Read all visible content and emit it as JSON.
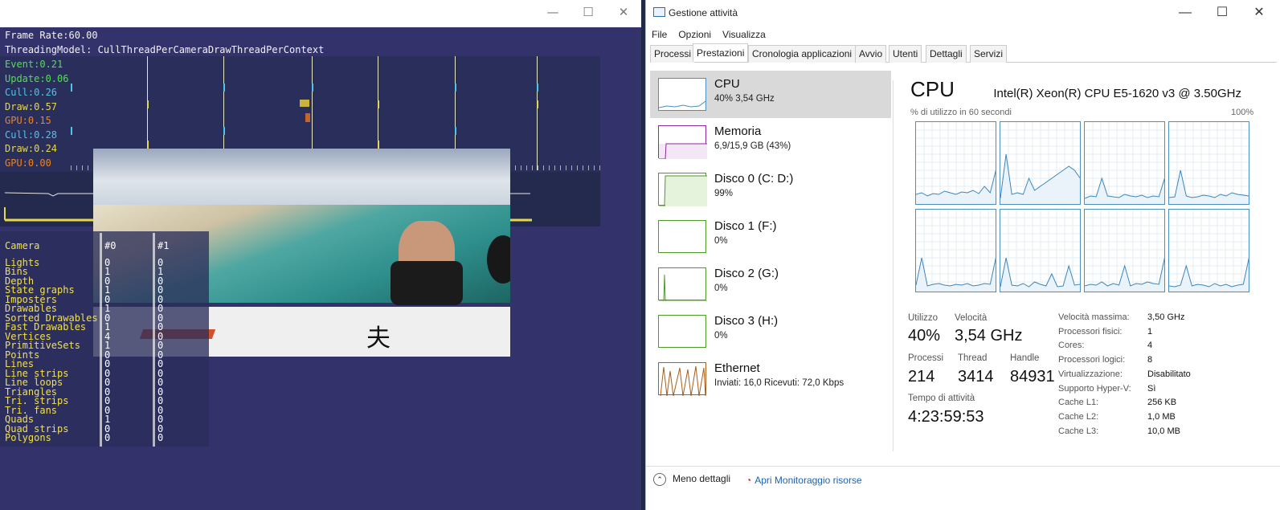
{
  "osg": {
    "frame_rate": "Frame Rate:60.00",
    "threading": "ThreadingModel: CullThreadPerCameraDrawThreadPerContext",
    "stats": [
      {
        "label": "Event:0.21",
        "color": "#4ee34e"
      },
      {
        "label": "Update:0.06",
        "color": "#4ee34e"
      },
      {
        "label": "Cull:0.26",
        "color": "#4cc7e6"
      },
      {
        "label": "Draw:0.57",
        "color": "#e6d84c"
      },
      {
        "label": "GPU:0.15",
        "color": "#e8842a"
      },
      {
        "label": "Cull:0.28",
        "color": "#4cc7e6"
      },
      {
        "label": "Draw:0.24",
        "color": "#e6d84c"
      },
      {
        "label": "GPU:0.00",
        "color": "#e8842a"
      }
    ],
    "camera": {
      "header": "Camera",
      "col0": "#0",
      "col1": "#1",
      "rows": [
        {
          "name": "Lights",
          "c0": "0",
          "c1": "0"
        },
        {
          "name": "Bins",
          "c0": "1",
          "c1": "1"
        },
        {
          "name": "Depth",
          "c0": "0",
          "c1": "0"
        },
        {
          "name": "State graphs",
          "c0": "1",
          "c1": "0"
        },
        {
          "name": "Imposters",
          "c0": "0",
          "c1": "0"
        },
        {
          "name": "Drawables",
          "c0": "1",
          "c1": "0"
        },
        {
          "name": "Sorted Drawables",
          "c0": "0",
          "c1": "0"
        },
        {
          "name": "Fast Drawables",
          "c0": "1",
          "c1": "0"
        },
        {
          "name": "Vertices",
          "c0": "4",
          "c1": "0"
        },
        {
          "name": "PrimitiveSets",
          "c0": "1",
          "c1": "0"
        },
        {
          "name": "Points",
          "c0": "0",
          "c1": "0"
        },
        {
          "name": "Lines",
          "c0": "0",
          "c1": "0"
        },
        {
          "name": "Line strips",
          "c0": "0",
          "c1": "0"
        },
        {
          "name": "Line loops",
          "c0": "0",
          "c1": "0"
        },
        {
          "name": "Triangles",
          "c0": "0",
          "c1": "0"
        },
        {
          "name": "Tri. strips",
          "c0": "0",
          "c1": "0"
        },
        {
          "name": "Tri. fans",
          "c0": "0",
          "c1": "0"
        },
        {
          "name": "Quads",
          "c0": "1",
          "c1": "0"
        },
        {
          "name": "Quad strips",
          "c0": "0",
          "c1": "0"
        },
        {
          "name": "Polygons",
          "c0": "0",
          "c1": "0"
        }
      ]
    },
    "window_controls": {
      "min": "—",
      "max": "☐",
      "close": "✕"
    }
  },
  "tm": {
    "title": "Gestione attività",
    "window_controls": {
      "min": "—",
      "max": "☐",
      "close": "✕"
    },
    "menu": [
      "File",
      "Opzioni",
      "Visualizza"
    ],
    "tabs": [
      "Processi",
      "Prestazioni",
      "Cronologia applicazioni",
      "Avvio",
      "Utenti",
      "Dettagli",
      "Servizi"
    ],
    "resources": [
      {
        "name": "CPU",
        "sub": "40% 3,54 GHz",
        "color": "#4b8fc0"
      },
      {
        "name": "Memoria",
        "sub": "6,9/15,9 GB (43%)",
        "color": "#8b2a9b"
      },
      {
        "name": "Disco 0 (C: D:)",
        "sub": "99%",
        "color": "#4d9a25"
      },
      {
        "name": "Disco 1 (F:)",
        "sub": "0%",
        "color": "#4d9a25"
      },
      {
        "name": "Disco 2 (G:)",
        "sub": "0%",
        "color": "#4d9a25"
      },
      {
        "name": "Disco 3 (H:)",
        "sub": "0%",
        "color": "#4d9a25"
      },
      {
        "name": "Ethernet",
        "sub": "Inviati: 16,0 Ricevuti: 72,0 Kbps",
        "color": "#a85d1c"
      }
    ],
    "cpu": {
      "title": "CPU",
      "model": "Intel(R) Xeon(R) CPU E5-1620 v3 @ 3.50GHz",
      "caption": "% di utilizzo in 60 secondi",
      "max": "100%",
      "util_label": "Utilizzo",
      "util": "40%",
      "speed_label": "Velocità",
      "speed": "3,54 GHz",
      "proc_label": "Processi",
      "proc": "214",
      "thread_label": "Thread",
      "thread": "3414",
      "handle_label": "Handle",
      "handle": "84931",
      "uptime_label": "Tempo di attività",
      "uptime": "4:23:59:53",
      "specs": [
        {
          "k": "Velocità massima:",
          "v": "3,50 GHz"
        },
        {
          "k": "Processori fisici:",
          "v": "1"
        },
        {
          "k": "Cores:",
          "v": "4"
        },
        {
          "k": "Processori logici:",
          "v": "8"
        },
        {
          "k": "Virtualizzazione:",
          "v": "Disabilitato"
        },
        {
          "k": "Supporto Hyper-V:",
          "v": "Sì"
        },
        {
          "k": "Cache L1:",
          "v": "256 KB"
        },
        {
          "k": "Cache L2:",
          "v": "1,0 MB"
        },
        {
          "k": "Cache L3:",
          "v": "10,0 MB"
        }
      ]
    },
    "footer": {
      "less": "Meno dettagli",
      "monitor": "Apri Monitoraggio risorse"
    }
  }
}
